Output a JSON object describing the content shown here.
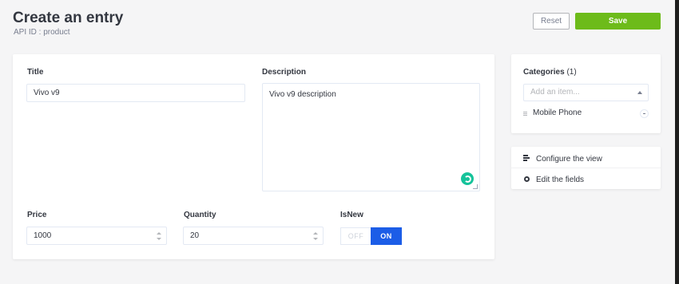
{
  "header": {
    "title": "Create an entry",
    "subtitle": "API ID : product",
    "reset_label": "Reset",
    "save_label": "Save"
  },
  "form": {
    "title": {
      "label": "Title",
      "value": "Vivo v9"
    },
    "description": {
      "label": "Description",
      "value": "Vivo v9 description"
    },
    "price": {
      "label": "Price",
      "value": "1000"
    },
    "quantity": {
      "label": "Quantity",
      "value": "20"
    },
    "isnew": {
      "label": "IsNew",
      "off_label": "OFF",
      "on_label": "ON",
      "selected": "ON"
    }
  },
  "categories": {
    "label": "Categories",
    "count": "(1)",
    "placeholder": "Add an item...",
    "items": [
      {
        "label": "Mobile Phone"
      }
    ]
  },
  "sidebar_links": {
    "configure_label": "Configure the view",
    "edit_label": "Edit the fields"
  },
  "colors": {
    "save_button": "#6dbb1a",
    "toggle_on": "#1c5de7",
    "grammarly": "#15c39a"
  }
}
